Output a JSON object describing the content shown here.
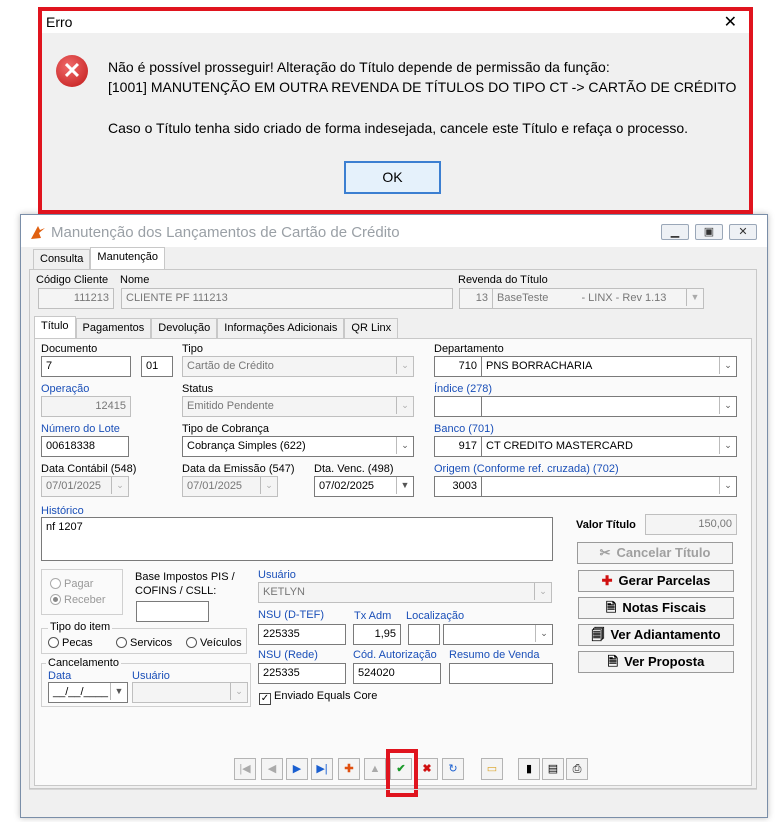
{
  "error_dialog": {
    "title": "Erro",
    "close_symbol": "✕",
    "line1": "Não é possível prosseguir! Alteração do Título depende de permissão da função:",
    "line2": "[1001] MANUTENÇÃO EM OUTRA REVENDA DE TÍTULOS DO TIPO CT -> CARTÃO DE CRÉDITO",
    "line3": "Caso o Título tenha sido criado de forma indesejada, cancele este Título e refaça o processo.",
    "ok_label": "OK",
    "icon": "error-icon",
    "highlight_color": "#e0141e"
  },
  "window": {
    "title": "Manutenção dos Lançamentos de Cartão de Crédito",
    "top_tabs": [
      "Consulta",
      "Manutenção"
    ],
    "active_top_tab": "Manutenção"
  },
  "header": {
    "codigo_cliente_label": "Código Cliente",
    "codigo_cliente": "111213",
    "nome_label": "Nome",
    "nome": "CLIENTE PF 111213",
    "revenda_label": "Revenda do Título",
    "revenda_num": "13",
    "revenda_nome": "BaseTeste",
    "revenda_desc": "- LINX - Rev 1.13"
  },
  "sub_tabs": [
    "Título",
    "Pagamentos",
    "Devolução",
    "Informações Adicionais",
    "QR Linx"
  ],
  "form": {
    "documento_label": "Documento",
    "documento": "7",
    "documento_seq": "01",
    "tipo_label": "Tipo",
    "tipo": "Cartão de Crédito",
    "departamento_label": "Departamento",
    "departamento_cod": "710",
    "departamento_nome": "PNS BORRACHARIA",
    "operacao_label": "Operação",
    "operacao": "12415",
    "status_label": "Status",
    "status": "Emitido Pendente",
    "indice_label": "Índice (278)",
    "numero_lote_label": "Número do Lote",
    "numero_lote": "00618338",
    "tipo_cobranca_label": "Tipo de Cobrança",
    "tipo_cobranca": "Cobrança Simples (622)",
    "banco_label": "Banco (701)",
    "banco_cod": "917",
    "banco_nome": "CT CREDITO MASTERCARD",
    "data_contabil_label": "Data Contábil (548)",
    "data_contabil": "07/01/2025",
    "data_emissao_label": "Data da Emissão (547)",
    "data_emissao": "07/01/2025",
    "dta_venc_label": "Dta. Venc. (498)",
    "dta_venc": "07/02/2025",
    "origem_label": "Origem (Conforme ref. cruzada) (702)",
    "origem_cod": "3003",
    "historico_label": "Histórico",
    "historico": "nf 1207",
    "valor_titulo_label": "Valor Título",
    "valor_titulo": "150,00",
    "pagar_label": "Pagar",
    "receber_label": "Receber",
    "base_impostos_label1": "Base Impostos PIS /",
    "base_impostos_label2": "COFINS / CSLL:",
    "usuario_label": "Usuário",
    "usuario": "KETLYN",
    "tipo_item_label": "Tipo do item",
    "pecas_label": "Pecas",
    "servicos_label": "Servicos",
    "veiculos_label": "Veículos",
    "nsu_dtef_label": "NSU (D-TEF)",
    "nsu_dtef": "225335",
    "tx_adm_label": "Tx Adm",
    "tx_adm": "1,95",
    "localizacao_label": "Localização",
    "cancelamento_label": "Cancelamento",
    "cancel_data_label": "Data",
    "cancel_usuario_label": "Usuário",
    "cancel_data": "__/__/____",
    "nsu_rede_label": "NSU (Rede)",
    "nsu_rede": "225335",
    "cod_autorizacao_label": "Cód. Autorização",
    "cod_autorizacao": "524020",
    "resumo_venda_label": "Resumo de Venda",
    "enviado_equals_label": "Enviado Equals Core"
  },
  "actions": {
    "cancelar_titulo": "Cancelar Título",
    "gerar_parcelas": "Gerar Parcelas",
    "notas_fiscais": "Notas Fiscais",
    "ver_adiantamento": "Ver Adiantamento",
    "ver_proposta": "Ver Proposta"
  },
  "toolbar": {
    "highlight_color": "#e0141e"
  }
}
